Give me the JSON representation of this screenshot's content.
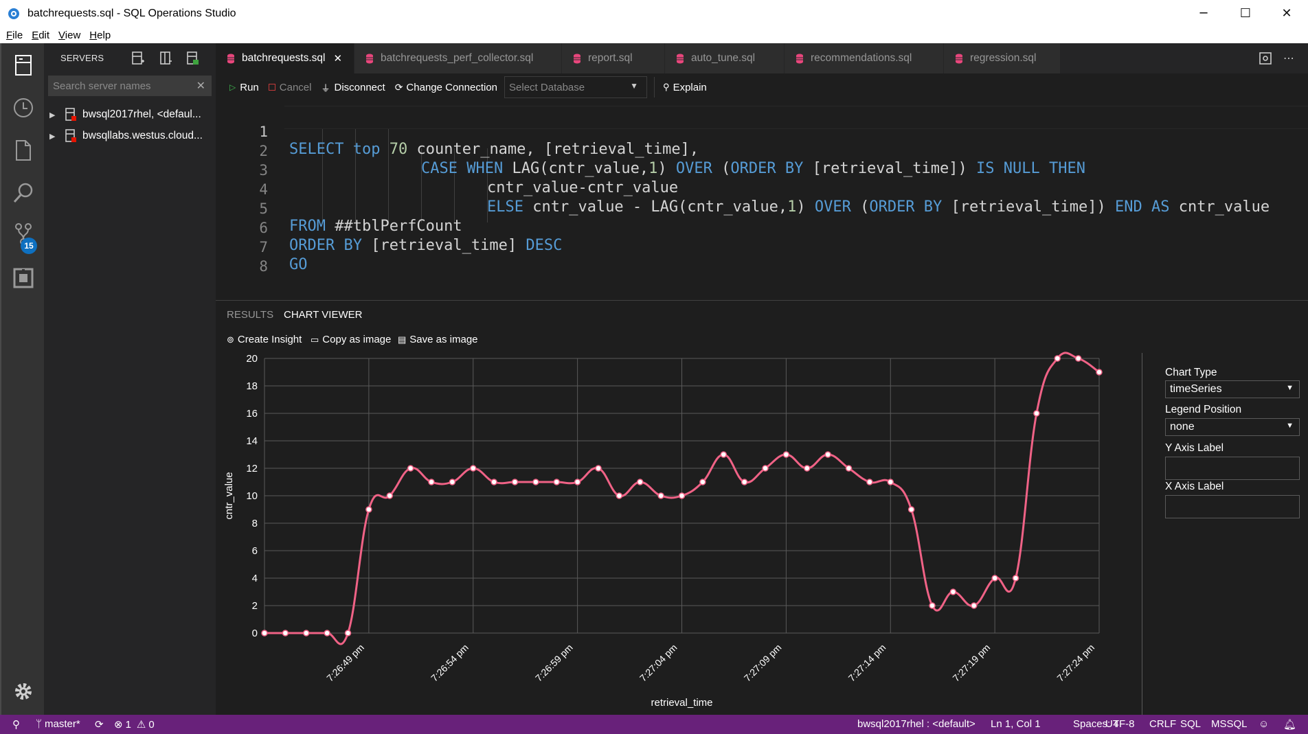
{
  "window": {
    "title": "batchrequests.sql - SQL Operations Studio"
  },
  "menu": [
    "File",
    "Edit",
    "View",
    "Help"
  ],
  "activity": {
    "badge_count": "15"
  },
  "sidebar": {
    "header": "SERVERS",
    "search_placeholder": "Search server names",
    "servers": [
      {
        "label": "bwsql2017rhel, <defaul..."
      },
      {
        "label": "bwsqllabs.westus.cloud..."
      }
    ]
  },
  "tabs": [
    {
      "label": "batchrequests.sql",
      "active": true
    },
    {
      "label": "batchrequests_perf_collector.sql"
    },
    {
      "label": "report.sql"
    },
    {
      "label": "auto_tune.sql"
    },
    {
      "label": "recommendations.sql"
    },
    {
      "label": "regression.sql"
    }
  ],
  "toolbar": {
    "run": "Run",
    "cancel": "Cancel",
    "disconnect": "Disconnect",
    "change_connection": "Change Connection",
    "select_db_placeholder": "Select Database",
    "explain": "Explain"
  },
  "code": {
    "line_numbers": [
      "1",
      "2",
      "3",
      "4",
      "5",
      "6",
      "7",
      "8"
    ],
    "l1": {
      "a": "SELECT",
      "b": " ",
      "c": "top",
      "d": " ",
      "e": "70",
      "f": " counter_name, [retrieval_time],"
    },
    "l2": {
      "a": "CASE WHEN",
      "b": " LAG(cntr_value,",
      "c": "1",
      "d": ") ",
      "e": "OVER",
      "f": " (",
      "g": "ORDER BY",
      "h": " [retrieval_time]) ",
      "i": "IS NULL THEN"
    },
    "l3": {
      "a": "cntr_value-cntr_value"
    },
    "l4": {
      "a": "ELSE",
      "b": " cntr_value - LAG(cntr_value,",
      "c": "1",
      "d": ") ",
      "e": "OVER",
      "f": " (",
      "g": "ORDER BY",
      "h": " [retrieval_time]) ",
      "i": "END AS",
      "j": " cntr_value"
    },
    "l5": {
      "a": "FROM",
      "b": " ##tblPerfCount"
    },
    "l6": {
      "a": "ORDER BY",
      "b": " [retrieval_time] ",
      "c": "DESC"
    },
    "l7": {
      "a": "GO"
    }
  },
  "panel": {
    "tabs": [
      "RESULTS",
      "CHART VIEWER"
    ],
    "actions": [
      "Create Insight",
      "Copy as image",
      "Save as image"
    ]
  },
  "chart_properties": {
    "chart_type_label": "Chart Type",
    "chart_type_value": "timeSeries",
    "legend_position_label": "Legend Position",
    "legend_position_value": "none",
    "y_axis_label": "Y Axis Label",
    "x_axis_label": "X Axis Label"
  },
  "chart_data": {
    "type": "line",
    "xlabel": "retrieval_time",
    "ylabel": "cntr_value",
    "ylim": [
      0,
      20
    ],
    "yticks": [
      0,
      2,
      4,
      6,
      8,
      10,
      12,
      14,
      16,
      18,
      20
    ],
    "xtick_labels": [
      "7:26:49 pm",
      "7:26:54 pm",
      "7:26:59 pm",
      "7:27:04 pm",
      "7:27:09 pm",
      "7:27:14 pm",
      "7:27:19 pm",
      "7:27:24 pm"
    ],
    "grid": true,
    "color": "#f06286",
    "series": [
      {
        "values": [
          0,
          0,
          0,
          0,
          0,
          9,
          10,
          12,
          11,
          11,
          12,
          11,
          11,
          11,
          11,
          11,
          12,
          10,
          11,
          10,
          10,
          11,
          13,
          11,
          12,
          13,
          12,
          13,
          12,
          11,
          11,
          9,
          2,
          3,
          2,
          4,
          4,
          16,
          20,
          20,
          19
        ]
      }
    ]
  },
  "statusbar": {
    "branch": "master*",
    "errors": "1",
    "warnings": "0",
    "connection": "bwsql2017rhel : <default>",
    "position": "Ln 1, Col 1",
    "spaces": "Spaces: 4",
    "encoding": "UTF-8",
    "eol": "CRLF",
    "language": "SQL",
    "provider": "MSSQL"
  }
}
